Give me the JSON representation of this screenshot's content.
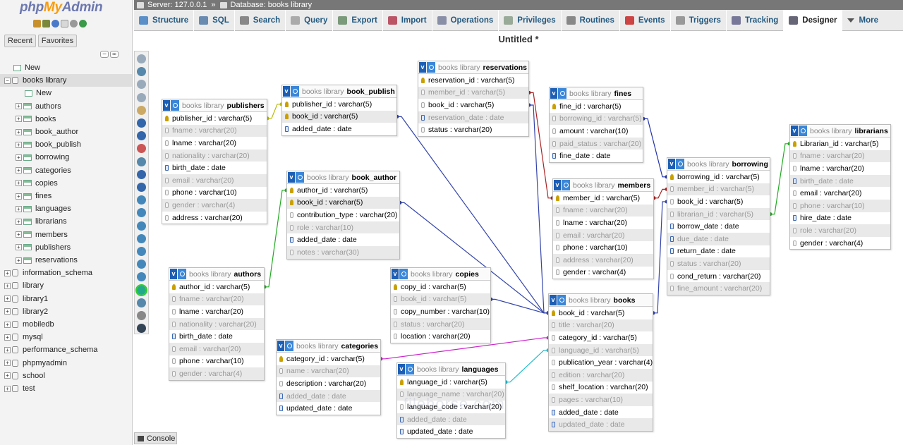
{
  "nav": {
    "logo_php": "php",
    "logo_my": "My",
    "logo_admin": "Admin",
    "tabs": [
      "Recent",
      "Favorites"
    ],
    "tree": [
      {
        "label": "New",
        "kind": "new",
        "level": 0
      },
      {
        "label": "books library",
        "kind": "db",
        "level": 0,
        "expanded": true,
        "selected": true
      },
      {
        "label": "New",
        "kind": "new",
        "level": 1
      },
      {
        "label": "authors",
        "kind": "table",
        "level": 1
      },
      {
        "label": "books",
        "kind": "table",
        "level": 1
      },
      {
        "label": "book_author",
        "kind": "table",
        "level": 1
      },
      {
        "label": "book_publish",
        "kind": "table",
        "level": 1
      },
      {
        "label": "borrowing",
        "kind": "table",
        "level": 1
      },
      {
        "label": "categories",
        "kind": "table",
        "level": 1
      },
      {
        "label": "copies",
        "kind": "table",
        "level": 1
      },
      {
        "label": "fines",
        "kind": "table",
        "level": 1
      },
      {
        "label": "languages",
        "kind": "table",
        "level": 1
      },
      {
        "label": "librarians",
        "kind": "table",
        "level": 1
      },
      {
        "label": "members",
        "kind": "table",
        "level": 1
      },
      {
        "label": "publishers",
        "kind": "table",
        "level": 1
      },
      {
        "label": "reservations",
        "kind": "table",
        "level": 1
      },
      {
        "label": "information_schema",
        "kind": "db",
        "level": 0
      },
      {
        "label": "library",
        "kind": "db",
        "level": 0
      },
      {
        "label": "library1",
        "kind": "db",
        "level": 0
      },
      {
        "label": "library2",
        "kind": "db",
        "level": 0
      },
      {
        "label": "mobiledb",
        "kind": "db",
        "level": 0
      },
      {
        "label": "mysql",
        "kind": "db",
        "level": 0
      },
      {
        "label": "performance_schema",
        "kind": "db",
        "level": 0
      },
      {
        "label": "phpmyadmin",
        "kind": "db",
        "level": 0
      },
      {
        "label": "school",
        "kind": "db",
        "level": 0
      },
      {
        "label": "test",
        "kind": "db",
        "level": 0
      }
    ]
  },
  "topbar": {
    "server": "Server: 127.0.0.1",
    "database": "Database: books library"
  },
  "menu": [
    {
      "label": "Structure",
      "icon": "structure-icon",
      "color": "#5a8fc8"
    },
    {
      "label": "SQL",
      "icon": "sql-icon",
      "color": "#6a8bb0"
    },
    {
      "label": "Search",
      "icon": "search-icon",
      "color": "#888"
    },
    {
      "label": "Query",
      "icon": "query-icon",
      "color": "#aaa"
    },
    {
      "label": "Export",
      "icon": "export-icon",
      "color": "#7a9a7a"
    },
    {
      "label": "Import",
      "icon": "import-icon",
      "color": "#b56"
    },
    {
      "label": "Operations",
      "icon": "wrench-icon",
      "color": "#8a8fa8"
    },
    {
      "label": "Privileges",
      "icon": "privileges-icon",
      "color": "#9a9"
    },
    {
      "label": "Routines",
      "icon": "routines-icon",
      "color": "#888"
    },
    {
      "label": "Events",
      "icon": "events-icon",
      "color": "#c44"
    },
    {
      "label": "Triggers",
      "icon": "triggers-icon",
      "color": "#999"
    },
    {
      "label": "Tracking",
      "icon": "tracking-icon",
      "color": "#779"
    },
    {
      "label": "Designer",
      "icon": "designer-icon",
      "color": "#667",
      "active": true
    },
    {
      "label": "More",
      "icon": "chevron-down-icon",
      "color": "#555"
    }
  ],
  "page_title": "Untitled *",
  "console_label": "Console",
  "watermark": "filehorse.com",
  "tables": [
    {
      "id": "publishers",
      "db": "books library",
      "name": "publishers",
      "fields": [
        {
          "text": "publisher_id : varchar(5)",
          "icon": "pk",
          "dim": false
        },
        {
          "text": "fname : varchar(20)",
          "icon": "col",
          "dim": true
        },
        {
          "text": "lname : varchar(20)",
          "icon": "col",
          "dim": false
        },
        {
          "text": "nationality : varchar(20)",
          "icon": "col",
          "dim": true
        },
        {
          "text": "birth_date : date",
          "icon": "dt",
          "dim": false
        },
        {
          "text": "email : varchar(20)",
          "icon": "col",
          "dim": true
        },
        {
          "text": "phone : varchar(10)",
          "icon": "col",
          "dim": false
        },
        {
          "text": "gender : varchar(4)",
          "icon": "col",
          "dim": true
        },
        {
          "text": "address : varchar(20)",
          "icon": "col",
          "dim": false
        }
      ]
    },
    {
      "id": "book_publish",
      "db": "books library",
      "name": "book_publish",
      "fields": [
        {
          "text": "publisher_id : varchar(5)",
          "icon": "pk",
          "dim": false
        },
        {
          "text": "book_id : varchar(5)",
          "icon": "pk",
          "dim": false
        },
        {
          "text": "added_date : date",
          "icon": "dt",
          "dim": false
        }
      ]
    },
    {
      "id": "reservations",
      "db": "books library",
      "name": "reservations",
      "fields": [
        {
          "text": "reservation_id : varchar(5)",
          "icon": "pk",
          "dim": false
        },
        {
          "text": "member_id : varchar(5)",
          "icon": "col",
          "dim": true
        },
        {
          "text": "book_id : varchar(5)",
          "icon": "col",
          "dim": false
        },
        {
          "text": "reservation_date : date",
          "icon": "dt",
          "dim": true
        },
        {
          "text": "status : varchar(20)",
          "icon": "col",
          "dim": false
        }
      ]
    },
    {
      "id": "fines",
      "db": "books library",
      "name": "fines",
      "fields": [
        {
          "text": "fine_id : varchar(5)",
          "icon": "pk",
          "dim": false
        },
        {
          "text": "borrowing_id : varchar(5)",
          "icon": "col",
          "dim": true
        },
        {
          "text": "amount : varchar(10)",
          "icon": "col",
          "dim": false
        },
        {
          "text": "paid_status : varchar(20)",
          "icon": "col",
          "dim": true
        },
        {
          "text": "fine_date : date",
          "icon": "dt",
          "dim": false
        }
      ]
    },
    {
      "id": "librarians",
      "db": "books library",
      "name": "librarians",
      "fields": [
        {
          "text": "Librarian_id : varchar(5)",
          "icon": "pk",
          "dim": false
        },
        {
          "text": "fname : varchar(20)",
          "icon": "col",
          "dim": true
        },
        {
          "text": "lname : varchar(20)",
          "icon": "col",
          "dim": false
        },
        {
          "text": "birth_date : date",
          "icon": "dt",
          "dim": true
        },
        {
          "text": "email : varchar(20)",
          "icon": "col",
          "dim": false
        },
        {
          "text": "phone : varchar(10)",
          "icon": "col",
          "dim": true
        },
        {
          "text": "hire_date : date",
          "icon": "dt",
          "dim": false
        },
        {
          "text": "role : varchar(20)",
          "icon": "col",
          "dim": true
        },
        {
          "text": "gender : varchar(4)",
          "icon": "col",
          "dim": false
        }
      ]
    },
    {
      "id": "borrowing",
      "db": "books library",
      "name": "borrowing",
      "fields": [
        {
          "text": "borrowing_id : varchar(5)",
          "icon": "pk",
          "dim": false
        },
        {
          "text": "member_id : varchar(5)",
          "icon": "col",
          "dim": true
        },
        {
          "text": "book_id : varchar(5)",
          "icon": "col",
          "dim": false
        },
        {
          "text": "librarian_id : varchar(5)",
          "icon": "col",
          "dim": true
        },
        {
          "text": "borrow_date : date",
          "icon": "dt",
          "dim": false
        },
        {
          "text": "due_date : date",
          "icon": "dt",
          "dim": true
        },
        {
          "text": "return_date : date",
          "icon": "dt",
          "dim": false
        },
        {
          "text": "status : varchar(20)",
          "icon": "col",
          "dim": true
        },
        {
          "text": "cond_return : varchar(20)",
          "icon": "col",
          "dim": false
        },
        {
          "text": "fine_amount : varchar(20)",
          "icon": "col",
          "dim": true
        }
      ]
    },
    {
      "id": "members",
      "db": "books library",
      "name": "members",
      "fields": [
        {
          "text": "member_id : varchar(5)",
          "icon": "pk",
          "dim": false
        },
        {
          "text": "fname : varchar(20)",
          "icon": "col",
          "dim": true
        },
        {
          "text": "lname : varchar(20)",
          "icon": "col",
          "dim": false
        },
        {
          "text": "email : varchar(20)",
          "icon": "col",
          "dim": true
        },
        {
          "text": "phone : varchar(10)",
          "icon": "col",
          "dim": false
        },
        {
          "text": "address : varchar(20)",
          "icon": "col",
          "dim": true
        },
        {
          "text": "gender : varchar(4)",
          "icon": "col",
          "dim": false
        }
      ]
    },
    {
      "id": "book_author",
      "db": "books library",
      "name": "book_author",
      "fields": [
        {
          "text": "author_id : varchar(5)",
          "icon": "pk",
          "dim": false
        },
        {
          "text": "book_id : varchar(5)",
          "icon": "pk",
          "dim": false
        },
        {
          "text": "contribution_type : varchar(20)",
          "icon": "col",
          "dim": false
        },
        {
          "text": "role : varchar(10)",
          "icon": "col",
          "dim": true
        },
        {
          "text": "added_date : date",
          "icon": "dt",
          "dim": false
        },
        {
          "text": "notes : varchar(30)",
          "icon": "col",
          "dim": true
        }
      ]
    },
    {
      "id": "authors",
      "db": "books library",
      "name": "authors",
      "fields": [
        {
          "text": "author_id : varchar(5)",
          "icon": "pk",
          "dim": false
        },
        {
          "text": "fname : varchar(20)",
          "icon": "col",
          "dim": true
        },
        {
          "text": "lname : varchar(20)",
          "icon": "col",
          "dim": false
        },
        {
          "text": "nationality : varchar(20)",
          "icon": "col",
          "dim": true
        },
        {
          "text": "birth_date : date",
          "icon": "dt",
          "dim": false
        },
        {
          "text": "email : varchar(20)",
          "icon": "col",
          "dim": true
        },
        {
          "text": "phone : varchar(10)",
          "icon": "col",
          "dim": false
        },
        {
          "text": "gender : varchar(4)",
          "icon": "col",
          "dim": true
        }
      ]
    },
    {
      "id": "copies",
      "db": "books library",
      "name": "copies",
      "fields": [
        {
          "text": "copy_id : varchar(5)",
          "icon": "pk",
          "dim": false
        },
        {
          "text": "book_id : varchar(5)",
          "icon": "col",
          "dim": true
        },
        {
          "text": "copy_number : varchar(10)",
          "icon": "col",
          "dim": false
        },
        {
          "text": "status : varchar(20)",
          "icon": "col",
          "dim": true
        },
        {
          "text": "location : varchar(20)",
          "icon": "col",
          "dim": false
        }
      ]
    },
    {
      "id": "books",
      "db": "books library",
      "name": "books",
      "fields": [
        {
          "text": "book_id : varchar(5)",
          "icon": "pk",
          "dim": false
        },
        {
          "text": "title : varchar(20)",
          "icon": "col",
          "dim": true
        },
        {
          "text": "category_id : varchar(5)",
          "icon": "col",
          "dim": false
        },
        {
          "text": "language_id : varchar(5)",
          "icon": "col",
          "dim": true
        },
        {
          "text": "publication_year : varchar(4)",
          "icon": "col",
          "dim": false
        },
        {
          "text": "edition : varchar(20)",
          "icon": "col",
          "dim": true
        },
        {
          "text": "shelf_location : varchar(20)",
          "icon": "col",
          "dim": false
        },
        {
          "text": "pages : varchar(10)",
          "icon": "col",
          "dim": true
        },
        {
          "text": "added_date : date",
          "icon": "dt",
          "dim": false
        },
        {
          "text": "updated_date : date",
          "icon": "dt",
          "dim": true
        }
      ]
    },
    {
      "id": "categories",
      "db": "books library",
      "name": "categories",
      "fields": [
        {
          "text": "category_id : varchar(5)",
          "icon": "pk",
          "dim": false
        },
        {
          "text": "name : varchar(20)",
          "icon": "col",
          "dim": true
        },
        {
          "text": "description : varchar(20)",
          "icon": "col",
          "dim": false
        },
        {
          "text": "added_date : date",
          "icon": "dt",
          "dim": true
        },
        {
          "text": "updated_date : date",
          "icon": "dt",
          "dim": false
        }
      ]
    },
    {
      "id": "languages",
      "db": "books library",
      "name": "languages",
      "fields": [
        {
          "text": "language_id : varchar(5)",
          "icon": "pk",
          "dim": false
        },
        {
          "text": "language_name : varchar(20)",
          "icon": "col",
          "dim": true
        },
        {
          "text": "language_code : varchar(20)",
          "icon": "col",
          "dim": false
        },
        {
          "text": "added_date : date",
          "icon": "dt",
          "dim": true
        },
        {
          "text": "updated_date : date",
          "icon": "dt",
          "dim": false
        }
      ]
    }
  ],
  "relation_colors": {
    "publisher": "#b8b800",
    "author": "#22aa22",
    "book": "#3344aa",
    "member": "#aa2222",
    "category": "#cc22cc",
    "language": "#22bbcc",
    "borrowing": "#2233aa",
    "librarian": "#22aa22"
  }
}
